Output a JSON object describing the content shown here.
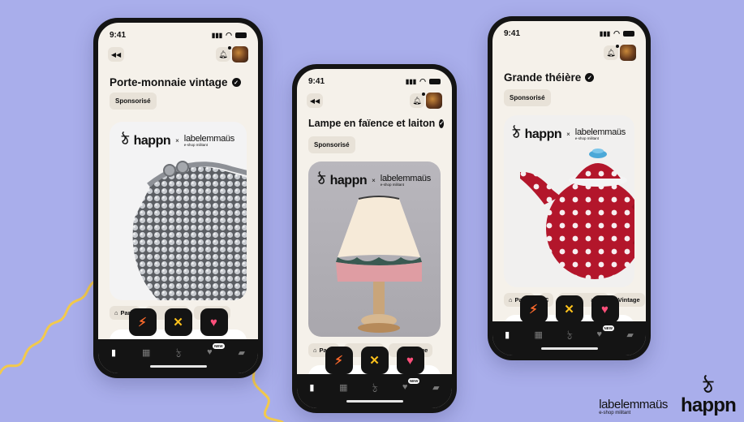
{
  "colors": {
    "background": "#a9aeeb",
    "phone_frame": "#141414",
    "screen": "#f5f1ea",
    "chip": "#e8e2d8",
    "flash": "#ff6a2b",
    "nope": "#ffc21c",
    "like": "#ff4f7a",
    "squiggle": "#f2c94c"
  },
  "icons": {
    "back": "rewind-icon",
    "bell": "bell-icon",
    "verified": "verified-check-icon",
    "flash": "lightning-icon",
    "nope": "close-icon",
    "like": "heart-icon",
    "location": "home-pin-icon",
    "nav": [
      "cards-icon",
      "grid-icon",
      "happn-icon",
      "heart-new-icon",
      "messages-icon"
    ]
  },
  "common": {
    "time": "9:41",
    "sponsor_label": "Sponsorisé",
    "brand_happn": "happn",
    "brand_x": "×",
    "brand_label": "labelemmaüs",
    "brand_label_sub": "e-shop militant",
    "new_badge": "NEW",
    "tag_paris": "Paris",
    "tag_vintage": "Vintage"
  },
  "phones": [
    {
      "title": "Porte-monnaie vintage",
      "tags": [
        "Paris",
        "F",
        "ge"
      ]
    },
    {
      "title": "Lampe en faïence et laiton",
      "tags": [
        "Paris",
        "D",
        "ntage"
      ]
    },
    {
      "title": "Grande théière",
      "tags": [
        "Paris",
        "C",
        "aion",
        "Vintage"
      ]
    }
  ],
  "footer": {
    "label_brand": "labelemmaüs",
    "label_sub": "e-shop militant",
    "happn_mark": "ঠ",
    "happn_word": "happn"
  }
}
